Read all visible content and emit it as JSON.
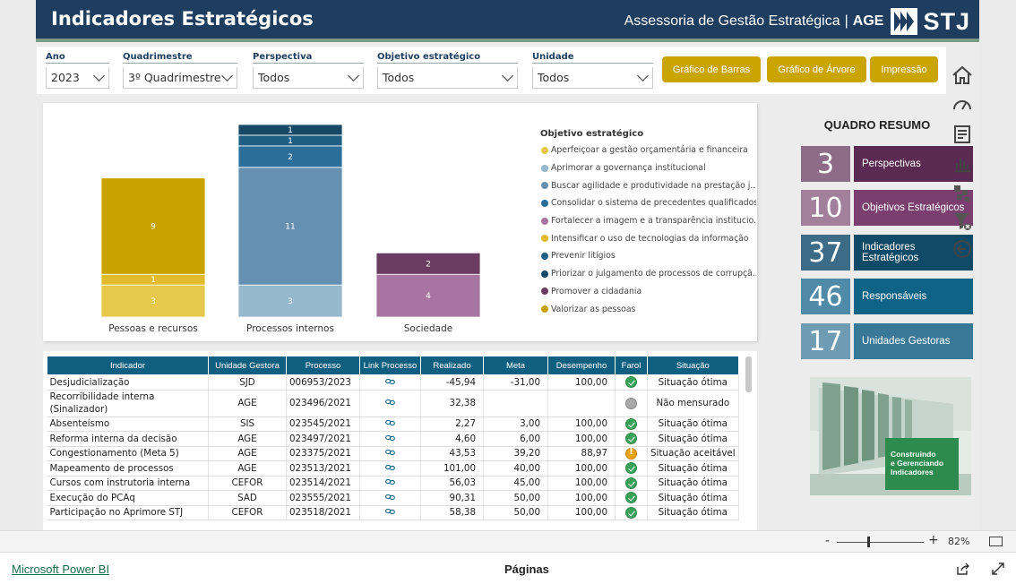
{
  "header": {
    "title": "Indicadores Estratégicos",
    "org": "Assessoria de Gestão Estratégica",
    "separator": "|",
    "unit": "AGE",
    "logo_text": "STJ"
  },
  "filters": [
    {
      "label": "Ano",
      "value": "2023"
    },
    {
      "label": "Quadrimestre",
      "value": "3º Quadrimestre"
    },
    {
      "label": "Perspectiva",
      "value": "Todos"
    },
    {
      "label": "Objetivo estratégico",
      "value": "Todos"
    },
    {
      "label": "Unidade",
      "value": "Todos"
    }
  ],
  "buttons": {
    "bar_chart": "Gráfico de Barras",
    "tree_chart": "Gráfico de Árvore",
    "print": "Impressão"
  },
  "colors": {
    "accent_gold": "#c8a500",
    "header_navy": "#1f3d5e",
    "table_header": "#0f5f80"
  },
  "chart_data": {
    "type": "bar",
    "stacked": true,
    "categories": [
      "Pessoas e recursos",
      "Processos internos",
      "Sociedade"
    ],
    "legend_title": "Objetivo estratégico",
    "series": [
      {
        "name": "Aperfeiçoar a gestão orçamentária e financeira",
        "color": "#e6c84a",
        "values": [
          3,
          0,
          0
        ]
      },
      {
        "name": "Aprimorar a governança institucional",
        "color": "#94b8cd",
        "values": [
          0,
          3,
          0
        ]
      },
      {
        "name": "Buscar agilidade e produtividade na prestação j...",
        "color": "#6690b2",
        "values": [
          0,
          11,
          0
        ]
      },
      {
        "name": "Consolidar o sistema de precedentes qualificados",
        "color": "#2a6e99",
        "values": [
          0,
          2,
          0
        ]
      },
      {
        "name": "Fortalecer a imagem e a transparência institucio...",
        "color": "#a874a0",
        "values": [
          0,
          0,
          4
        ]
      },
      {
        "name": "Intensificar o uso de tecnologias da informação",
        "color": "#e0bc2c",
        "values": [
          1,
          0,
          0
        ]
      },
      {
        "name": "Prevenir litígios",
        "color": "#1e5e85",
        "values": [
          0,
          1,
          0
        ]
      },
      {
        "name": "Priorizar o julgamento de processos de corrupçã...",
        "color": "#174a66",
        "values": [
          0,
          1,
          0
        ]
      },
      {
        "name": "Promover a cidadania",
        "color": "#6b3c62",
        "values": [
          0,
          0,
          2
        ]
      },
      {
        "name": "Valorizar as pessoas",
        "color": "#c7a300",
        "values": [
          9,
          0,
          0
        ]
      }
    ],
    "stacks": [
      {
        "category": "Pessoas e recursos",
        "segments": [
          {
            "series": 0,
            "value": 3
          },
          {
            "series": 5,
            "value": 1
          },
          {
            "series": 9,
            "value": 9
          }
        ]
      },
      {
        "category": "Processos internos",
        "segments": [
          {
            "series": 1,
            "value": 3
          },
          {
            "series": 2,
            "value": 11
          },
          {
            "series": 3,
            "value": 2
          },
          {
            "series": 6,
            "value": 1
          },
          {
            "series": 7,
            "value": 1
          }
        ]
      },
      {
        "category": "Sociedade",
        "segments": [
          {
            "series": 4,
            "value": 4
          },
          {
            "series": 8,
            "value": 2
          }
        ]
      }
    ],
    "ylim": [
      0,
      18
    ],
    "legend_position": "right"
  },
  "table": {
    "columns": [
      "Indicador",
      "Unidade Gestora",
      "Processo",
      "Link Processo",
      "Realizado",
      "Meta",
      "Desempenho",
      "Farol",
      "Situação"
    ],
    "rows": [
      {
        "indicador": "Desjudicialização",
        "unidade": "SJD",
        "processo": "006953/2023",
        "realizado": "-45,94",
        "meta": "-31,00",
        "desempenho": "100,00",
        "farol": "ok",
        "situacao": "Situação ótima"
      },
      {
        "indicador": "Recorribilidade interna (Sinalizador)",
        "unidade": "AGE",
        "processo": "023496/2021",
        "realizado": "32,38",
        "meta": "",
        "desempenho": "",
        "farol": "na",
        "situacao": "Não mensurado"
      },
      {
        "indicador": "Absenteísmo",
        "unidade": "SIS",
        "processo": "023545/2021",
        "realizado": "2,27",
        "meta": "3,00",
        "desempenho": "100,00",
        "farol": "ok",
        "situacao": "Situação ótima"
      },
      {
        "indicador": "Reforma interna da decisão",
        "unidade": "AGE",
        "processo": "023497/2021",
        "realizado": "4,60",
        "meta": "6,00",
        "desempenho": "100,00",
        "farol": "ok",
        "situacao": "Situação ótima"
      },
      {
        "indicador": "Congestionamento (Meta 5)",
        "unidade": "AGE",
        "processo": "023375/2021",
        "realizado": "43,53",
        "meta": "39,20",
        "desempenho": "88,97",
        "farol": "warn",
        "situacao": "Situação aceitável"
      },
      {
        "indicador": "Mapeamento de processos",
        "unidade": "AGE",
        "processo": "023513/2021",
        "realizado": "101,00",
        "meta": "40,00",
        "desempenho": "100,00",
        "farol": "ok",
        "situacao": "Situação ótima"
      },
      {
        "indicador": "Cursos com instrutoria interna",
        "unidade": "CEFOR",
        "processo": "023514/2021",
        "realizado": "56,03",
        "meta": "45,00",
        "desempenho": "100,00",
        "farol": "ok",
        "situacao": "Situação ótima"
      },
      {
        "indicador": "Execução do PCAq",
        "unidade": "SAD",
        "processo": "023555/2021",
        "realizado": "90,31",
        "meta": "50,00",
        "desempenho": "100,00",
        "farol": "ok",
        "situacao": "Situação ótima"
      },
      {
        "indicador": "Participação no Aprimore STJ",
        "unidade": "CEFOR",
        "processo": "023518/2021",
        "realizado": "58,38",
        "meta": "50,00",
        "desempenho": "100,00",
        "farol": "ok",
        "situacao": "Situação ótima"
      }
    ]
  },
  "summary": {
    "title": "QUADRO RESUMO",
    "items": [
      {
        "value": "3",
        "label": "Perspectivas",
        "num_color": "#8e6c87",
        "lbl_color": "#5b2a52"
      },
      {
        "value": "10",
        "label": "Objetivos Estratégicos",
        "num_color": "#a2809b",
        "lbl_color": "#7a3f6e"
      },
      {
        "value": "37",
        "label": "Indicadores Estratégicos",
        "num_color": "#3b6b86",
        "lbl_color": "#0f4a66"
      },
      {
        "value": "46",
        "label": "Responsáveis",
        "num_color": "#4f8ba8",
        "lbl_color": "#0f6486"
      },
      {
        "value": "17",
        "label": "Unidades Gestoras",
        "num_color": "#6f9bb3",
        "lbl_color": "#3a7898"
      }
    ]
  },
  "photo": {
    "caption_line1": "Construindo",
    "caption_line2": "e Gerenciando",
    "caption_line3": "Indicadores"
  },
  "zoom": {
    "minus": "-",
    "plus": "+",
    "percent": "82%"
  },
  "footer": {
    "powerbi": "Microsoft Power BI",
    "pages": "Páginas"
  }
}
